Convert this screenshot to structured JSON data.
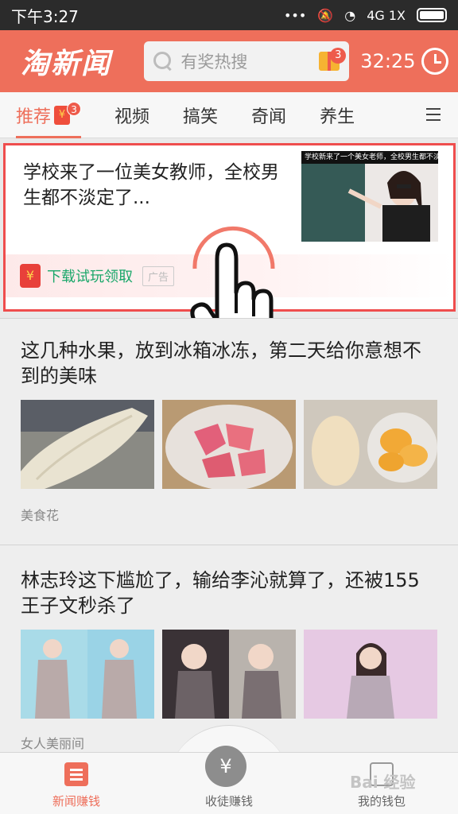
{
  "status_bar": {
    "time": "下午3:27",
    "network": "4G 1X"
  },
  "header": {
    "logo": "淘新闻",
    "search_placeholder": "有奖热搜",
    "gift_badge": "3",
    "timer": "32:25"
  },
  "tabs": {
    "items": [
      {
        "label": "推荐",
        "active": true,
        "badge": "3",
        "badge_icon": "¥"
      },
      {
        "label": "视频"
      },
      {
        "label": "搞笑"
      },
      {
        "label": "奇闻"
      },
      {
        "label": "养生"
      }
    ]
  },
  "feed": {
    "ad": {
      "title": "学校来了一位美女教师，全校男生都不淡定了...",
      "thumb_caption": "学校新来了一个美女老师，全校男生都不淡定",
      "cta": "下载试玩领取",
      "tag": "广告",
      "rp_icon": "¥"
    },
    "items": [
      {
        "title": "这几种水果，放到冰箱冰冻，第二天给你意想不到的美味",
        "source": "美食花"
      },
      {
        "title": "林志玲这下尴尬了，输给李沁就算了，还被155王子文秒杀了",
        "source": "女人美丽间"
      }
    ]
  },
  "bottom_nav": {
    "items": [
      {
        "label": "新闻赚钱",
        "active": true
      },
      {
        "label": "收徒赚钱"
      },
      {
        "label": "我的钱包"
      }
    ],
    "center_icon": "¥"
  },
  "watermark": "Bai 经验",
  "colors": {
    "accent": "#ee6f5b",
    "ad_border": "#ef4d4d",
    "cta": "#1aa76a"
  }
}
